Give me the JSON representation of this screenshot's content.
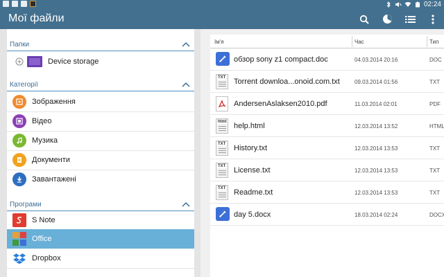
{
  "status_bar": {
    "time": "02:24"
  },
  "app": {
    "title": "Мої файли"
  },
  "toolbar": {
    "actions": [
      {
        "name": "search-icon"
      },
      {
        "name": "storage-usage-icon"
      },
      {
        "name": "list-view-icon"
      },
      {
        "name": "more-menu-icon"
      }
    ]
  },
  "sidebar": {
    "folders_header": "Папки",
    "folders": [
      {
        "label": "Device storage"
      }
    ],
    "categories_header": "Категорії",
    "categories": [
      {
        "label": "Зображення",
        "color": "#f08a2e"
      },
      {
        "label": "Відео",
        "color": "#8c3fb5"
      },
      {
        "label": "Музика",
        "color": "#7ab830"
      },
      {
        "label": "Документи",
        "color": "#f2a21e"
      },
      {
        "label": "Завантажені",
        "color": "#2f6fc0"
      }
    ],
    "apps_header": "Програми",
    "apps": [
      {
        "label": "S Note"
      },
      {
        "label": "Office",
        "selected": true
      },
      {
        "label": "Dropbox"
      }
    ]
  },
  "file_list": {
    "columns": {
      "name": "Ім'я",
      "time": "Час",
      "type": "Тип"
    },
    "rows": [
      {
        "icon": "doc",
        "name": "обзор sony z1 compact.doc",
        "time": "04.03.2014 20:16",
        "type": "DOC"
      },
      {
        "icon": "txt",
        "name": "Torrent downloa...onoid.com.txt",
        "time": "09.03.2014 01:56",
        "type": "TXT"
      },
      {
        "icon": "pdf",
        "name": "AndersenAslaksen2010.pdf",
        "time": "11.03.2014 02:01",
        "type": "PDF"
      },
      {
        "icon": "html",
        "name": "help.html",
        "time": "12.03.2014 13:52",
        "type": "HTML"
      },
      {
        "icon": "txt",
        "name": "History.txt",
        "time": "12.03.2014 13:53",
        "type": "TXT"
      },
      {
        "icon": "txt",
        "name": "License.txt",
        "time": "12.03.2014 13:53",
        "type": "TXT"
      },
      {
        "icon": "txt",
        "name": "Readme.txt",
        "time": "12.03.2014 13:53",
        "type": "TXT"
      },
      {
        "icon": "doc",
        "name": "day 5.docx",
        "time": "18.03.2014 02:24",
        "type": "DOCX"
      }
    ]
  }
}
